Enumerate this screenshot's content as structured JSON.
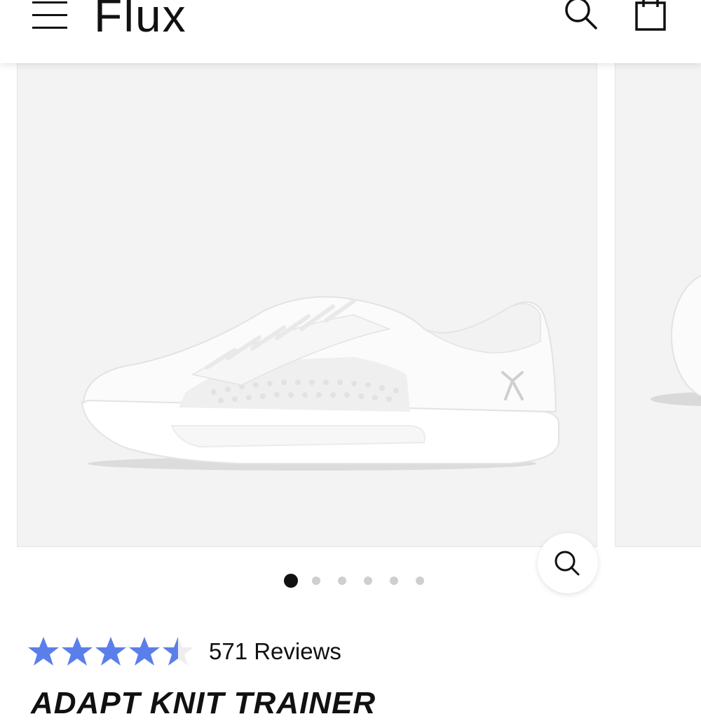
{
  "header": {
    "logo": "Flux",
    "menu_icon": "hamburger-menu-icon",
    "search_icon": "search-icon",
    "cart_icon": "shopping-bag-icon"
  },
  "gallery": {
    "image_alt": "White knit sneaker",
    "zoom_icon": "zoom-magnifier-icon",
    "slide_count": 6,
    "active_slide": 1
  },
  "product": {
    "rating": 4.5,
    "rating_max": 5,
    "star_color": "#5b7fea",
    "reviews_label": "571 Reviews",
    "title": "ADAPT KNIT TRAINER"
  }
}
